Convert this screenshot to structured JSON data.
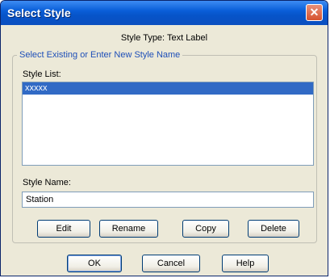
{
  "window": {
    "title": "Select Style"
  },
  "style_type": "Style Type: Text Label",
  "group": {
    "legend": "Select Existing or Enter New Style Name",
    "list_label": "Style List:",
    "list_items": [
      "xxxxx"
    ],
    "name_label": "Style Name:",
    "name_value": "Station"
  },
  "buttons": {
    "edit": "Edit",
    "rename": "Rename",
    "copy": "Copy",
    "delete": "Delete",
    "ok": "OK",
    "cancel": "Cancel",
    "help": "Help"
  },
  "icons": {
    "close": "close-icon"
  }
}
